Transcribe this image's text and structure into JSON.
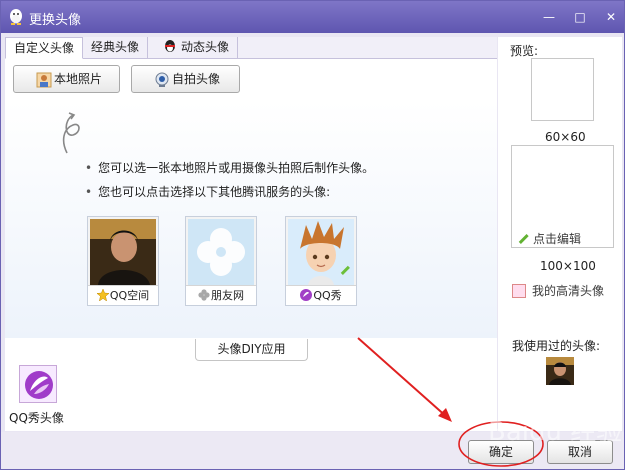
{
  "window": {
    "title": "更换头像",
    "controls": [
      "—",
      "□",
      "✕"
    ]
  },
  "tabs": [
    {
      "label": "自定义头像",
      "active": true
    },
    {
      "label": "经典头像",
      "active": false
    },
    {
      "label": "动态头像",
      "active": false
    }
  ],
  "toolbar": {
    "local_photo": "本地照片",
    "selfie": "自拍头像"
  },
  "content": {
    "bullet1": "您可以选一张本地照片或用摄像头拍照后制作头像。",
    "bullet2": "您也可以点击选择以下其他腾讯服务的头像:",
    "services": [
      {
        "label": "QQ空间",
        "icon": "star-icon"
      },
      {
        "label": "朋友网",
        "icon": "clover-icon"
      },
      {
        "label": "QQ秀",
        "icon": "qqxiu-icon"
      }
    ],
    "diy_label": "头像DIY应用"
  },
  "qqxiu_app": {
    "label": "QQ秀头像"
  },
  "right": {
    "preview_label": "预览:",
    "size_small": "60×60",
    "edit_label": "点击编辑",
    "size_large": "100×100",
    "hd_label": "我的高清头像",
    "used_label": "我使用过的头像:"
  },
  "footer": {
    "ok": "确定",
    "cancel": "取消"
  },
  "watermark": "Baidu 经验",
  "colors": {
    "titlebar": "#6a62b3",
    "annotation": "#e02020"
  }
}
